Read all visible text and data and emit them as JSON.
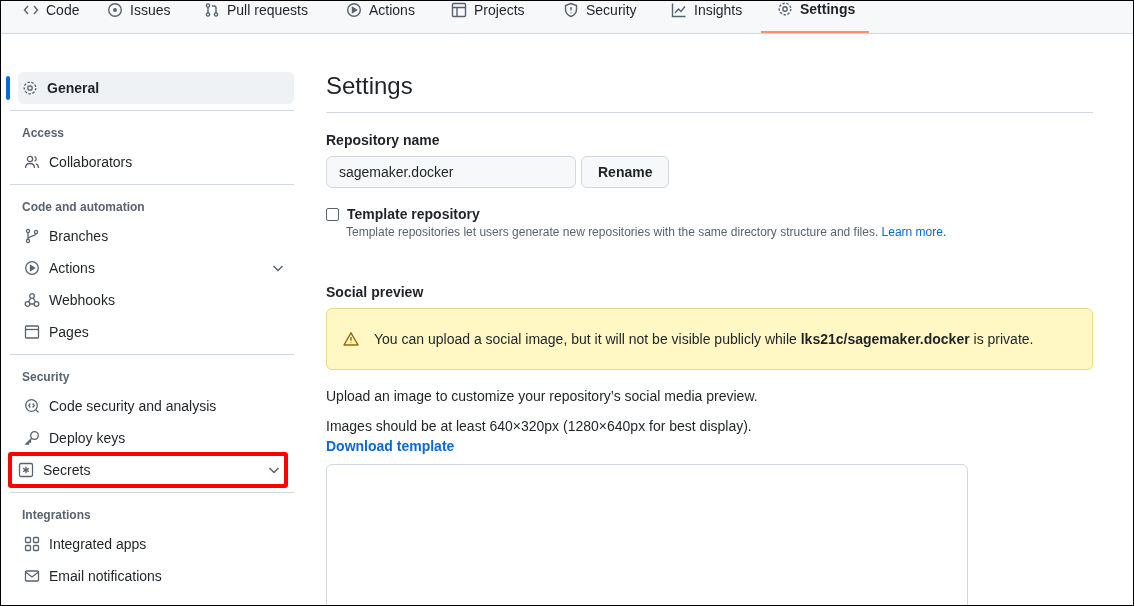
{
  "tabs": [
    {
      "label": "Code",
      "selected": false
    },
    {
      "label": "Issues",
      "selected": false
    },
    {
      "label": "Pull requests",
      "selected": false
    },
    {
      "label": "Actions",
      "selected": false
    },
    {
      "label": "Projects",
      "selected": false
    },
    {
      "label": "Security",
      "selected": false
    },
    {
      "label": "Insights",
      "selected": false
    },
    {
      "label": "Settings",
      "selected": true
    }
  ],
  "sidebar": {
    "sections": [
      {
        "items": [
          {
            "label": "General",
            "selected": true,
            "expandable": false,
            "highlighted": false
          }
        ]
      },
      {
        "heading": "Access",
        "items": [
          {
            "label": "Collaborators",
            "selected": false,
            "expandable": false,
            "highlighted": false
          }
        ]
      },
      {
        "heading": "Code and automation",
        "items": [
          {
            "label": "Branches",
            "selected": false,
            "expandable": false,
            "highlighted": false
          },
          {
            "label": "Actions",
            "selected": false,
            "expandable": true,
            "highlighted": false
          },
          {
            "label": "Webhooks",
            "selected": false,
            "expandable": false,
            "highlighted": false
          },
          {
            "label": "Pages",
            "selected": false,
            "expandable": false,
            "highlighted": false
          }
        ]
      },
      {
        "heading": "Security",
        "items": [
          {
            "label": "Code security and analysis",
            "selected": false,
            "expandable": false,
            "highlighted": false
          },
          {
            "label": "Deploy keys",
            "selected": false,
            "expandable": false,
            "highlighted": false
          },
          {
            "label": "Secrets",
            "selected": false,
            "expandable": true,
            "highlighted": true
          }
        ]
      },
      {
        "heading": "Integrations",
        "items": [
          {
            "label": "Integrated apps",
            "selected": false,
            "expandable": false,
            "highlighted": false
          },
          {
            "label": "Email notifications",
            "selected": false,
            "expandable": false,
            "highlighted": false
          }
        ]
      }
    ]
  },
  "main": {
    "title": "Settings",
    "repository_name": {
      "label": "Repository name",
      "value": "sagemaker.docker",
      "button": "Rename"
    },
    "template": {
      "label": "Template repository",
      "checked": false,
      "description": "Template repositories let users generate new repositories with the same directory structure and files.",
      "link": "Learn more."
    },
    "social_preview": {
      "heading": "Social preview",
      "warning": "You can upload a social image, but it will not be visible publicly while **lks21c/sagemaker.docker** is private.",
      "upload_text": "Upload an image to customize your repository’s social media preview.",
      "size_text": "Images should be at least 640×320px (1280×640px for best display).",
      "download_link": "Download template"
    }
  }
}
